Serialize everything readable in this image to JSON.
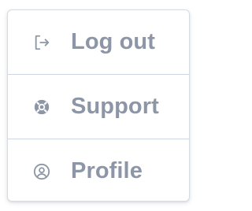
{
  "menu": {
    "items": [
      {
        "label": "Log out",
        "icon": "logout-icon"
      },
      {
        "label": "Support",
        "icon": "lifebuoy-icon"
      },
      {
        "label": "Profile",
        "icon": "user-circle-icon"
      }
    ],
    "colors": {
      "text": "#8c96a6",
      "icon": "#8c96a6",
      "border": "#d7dce3",
      "divider": "#cfd6df",
      "background": "#ffffff"
    }
  }
}
